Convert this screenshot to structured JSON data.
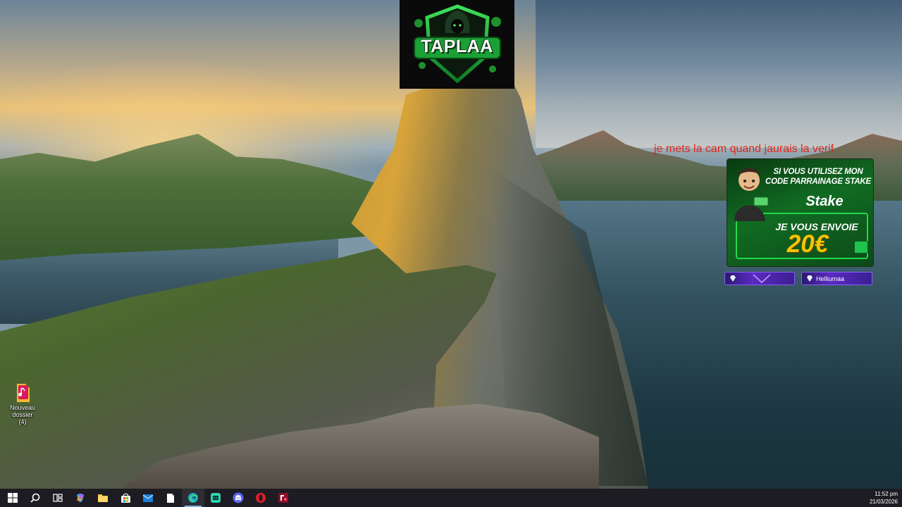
{
  "overlay": {
    "logo_text": "TAPLAA",
    "cam_note": "je mets la cam quand jaurais la verif"
  },
  "promo": {
    "line1": "SI VOUS UTILISEZ MON",
    "line2": "CODE PARRAINAGE STAKE",
    "brand": "Stake",
    "line3": "JE VOUS ENVOIE",
    "amount": "20€"
  },
  "gem_bars": [
    {
      "label": ""
    },
    {
      "label": "Helliumaa"
    }
  ],
  "desktop": {
    "icons": [
      {
        "label_line1": "Nouveau dossier",
        "label_line2": "(4)"
      }
    ]
  },
  "taskbar": {
    "items": [
      {
        "name": "start-button",
        "icon": "windows-logo-icon"
      },
      {
        "name": "search-button",
        "icon": "search-icon"
      },
      {
        "name": "task-view-button",
        "icon": "task-view-icon"
      },
      {
        "name": "copilot-button",
        "icon": "copilot-icon"
      },
      {
        "name": "file-explorer-button",
        "icon": "folder-icon"
      },
      {
        "name": "store-button",
        "icon": "store-icon"
      },
      {
        "name": "mail-button",
        "icon": "mail-icon"
      },
      {
        "name": "notepad-button",
        "icon": "document-icon"
      },
      {
        "name": "edge-button",
        "icon": "edge-icon",
        "active": true
      },
      {
        "name": "app-green-button",
        "icon": "app-icon"
      },
      {
        "name": "discord-button",
        "icon": "discord-icon"
      },
      {
        "name": "opera-button",
        "icon": "opera-icon"
      },
      {
        "name": "obs-button",
        "icon": "obs-icon"
      }
    ],
    "clock_time": "11:52 pm",
    "clock_date": "21/03/2026"
  },
  "colors": {
    "cam_note": "#e0261f",
    "taskbar": "#1c1c22",
    "promo_amount": "#f5c400",
    "logo_green": "#2fb43c"
  }
}
